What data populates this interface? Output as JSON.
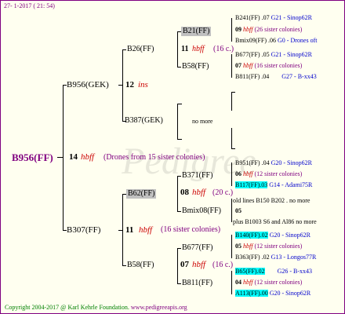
{
  "header": {
    "date": "27- 1-2017 ( 21: 54)"
  },
  "root": {
    "name": "B956(FF)",
    "gen": "14",
    "label": "hbff",
    "note": "(Drones from 15 sister colonies)"
  },
  "gen1": [
    {
      "name": "B956(GEK)",
      "gen": "12",
      "label": "ins"
    },
    {
      "name": "B307(FF)",
      "gen": "11",
      "label": "hbff",
      "note": "(16 sister colonies)"
    }
  ],
  "gen2": [
    {
      "name": "B26(FF)",
      "gen": "11",
      "label": "hbff",
      "note": "(16 c.)"
    },
    {
      "name": "B387(GEK)",
      "note": "no more"
    },
    {
      "name": "B62(FF)",
      "gen": "08",
      "label": "hbff",
      "note": "(20 c.)"
    },
    {
      "name": "B58(FF)",
      "gen": "07",
      "label": "hbff",
      "note": "(16 c.)"
    }
  ],
  "gen3": [
    {
      "name": "B21(FF)"
    },
    {
      "name": "B58(FF)"
    },
    {
      "name": "B371(FF)"
    },
    {
      "name": "Bmix08(FF)"
    },
    {
      "name": "B677(FF)"
    },
    {
      "name": "B811(FF)"
    }
  ],
  "gen4": [
    {
      "name": "B241(FF)",
      "val": ".07",
      "line": "G21 - Sinop62R"
    },
    {
      "gen": "09",
      "label": "hbff",
      "note": "(26 sister colonies)"
    },
    {
      "name": "Bmix09(FF)",
      "val": ".06",
      "line": "G0 - Drones oft"
    },
    {
      "name": "B677(FF)",
      "val": ".05",
      "line": "G21 - Sinop62R"
    },
    {
      "gen": "07",
      "label": "hbff",
      "note": "(16 sister colonies)"
    },
    {
      "name": "B811(FF)",
      "val": ".04",
      "line": "G27 - B-xx43"
    },
    {
      "name": "B951(FF)",
      "val": ".04",
      "line": "G20 - Sinop62R"
    },
    {
      "gen": "06",
      "label": "hbff",
      "note": "(12 sister colonies)"
    },
    {
      "name": "B117(FF)",
      "val": ".03",
      "line": "G14 - Adami75R"
    },
    {
      "text": "old lines B150 B202",
      "tail": ". no more"
    },
    {
      "gen": "05"
    },
    {
      "text": "plus B1003 S6 and Al86",
      "tail": "no more"
    },
    {
      "name": "B140(FF)",
      "val": ".02",
      "line": "G20 - Sinop62R"
    },
    {
      "gen": "05",
      "label": "hbff",
      "note": "(12 sister colonies)"
    },
    {
      "name": "B363(FF)",
      "val": ".02",
      "line": "G13 - Longos77R"
    },
    {
      "name": "B65(FF)",
      "val": ".02",
      "line": "G26 - B-xx43"
    },
    {
      "gen": "04",
      "label": "hbff",
      "note": "(12 sister colonies)"
    },
    {
      "name": "A113(FF)",
      "val": ".00",
      "line": "G20 - Sinop62R"
    }
  ],
  "footer": {
    "copyright": "Copyright 2004-2017 @ Karl Kehrle Foundation.",
    "url": "www.pedigreeapis.org"
  }
}
